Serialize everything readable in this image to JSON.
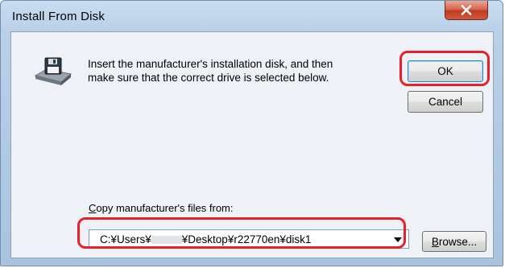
{
  "window": {
    "title": "Install From Disk"
  },
  "message": {
    "line1": "Insert the manufacturer's installation disk, and then",
    "line2": "make sure that the correct drive is selected below."
  },
  "buttons": {
    "ok": "OK",
    "cancel": "Cancel",
    "browse_prefix": "",
    "browse_accel": "B",
    "browse_rest": "rowse..."
  },
  "copy_from": {
    "label_accel": "C",
    "label_rest": "opy manufacturer's files from:",
    "path_start": "C:¥Users¥",
    "path_end": "¥Desktop¥r22770en¥disk1"
  },
  "icons": {
    "disk": "floppy-disk-drive-icon",
    "close": "close-icon",
    "dropdown": "chevron-down-icon"
  },
  "colors": {
    "highlight": "#e8202b",
    "close_button": "#c9462c",
    "titlebar": "#b9d0e8"
  }
}
